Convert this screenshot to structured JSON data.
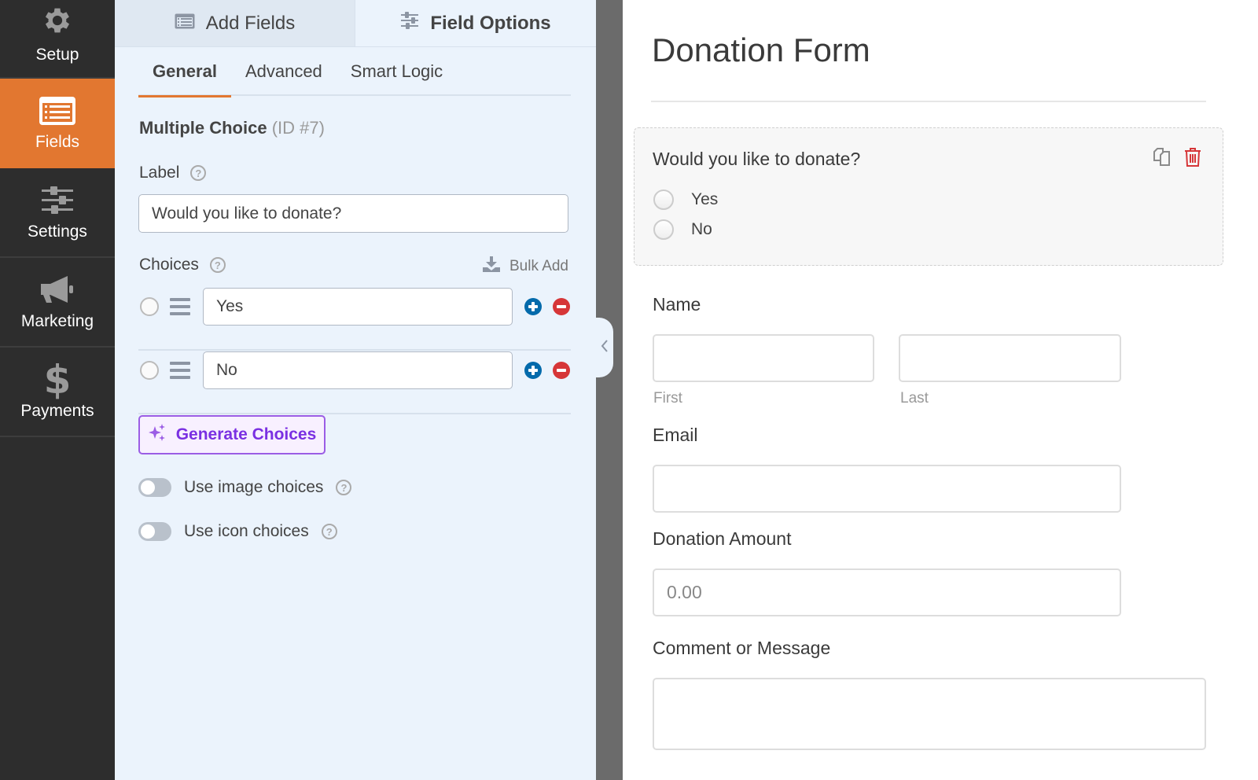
{
  "nav": {
    "items": [
      {
        "label": "Setup",
        "icon": "gear-icon",
        "active": false
      },
      {
        "label": "Fields",
        "icon": "list-form-icon",
        "active": true
      },
      {
        "label": "Settings",
        "icon": "sliders-icon",
        "active": false
      },
      {
        "label": "Marketing",
        "icon": "megaphone-icon",
        "active": false
      },
      {
        "label": "Payments",
        "icon": "dollar-icon",
        "active": false
      }
    ]
  },
  "panel": {
    "top_tabs": [
      {
        "label": "Add Fields",
        "icon": "list-icon",
        "active": false
      },
      {
        "label": "Field Options",
        "icon": "sliders-icon",
        "active": true
      }
    ],
    "sub_tabs": [
      {
        "label": "General",
        "active": true
      },
      {
        "label": "Advanced",
        "active": false
      },
      {
        "label": "Smart Logic",
        "active": false
      }
    ],
    "field_type": "Multiple Choice",
    "field_id": "(ID #7)",
    "label_caption": "Label",
    "label_value": "Would you like to donate?",
    "choices_caption": "Choices",
    "bulk_add": "Bulk Add",
    "choices": [
      {
        "value": "Yes"
      },
      {
        "value": "No"
      }
    ],
    "generate_button": "Generate Choices",
    "toggles": [
      {
        "label": "Use image choices",
        "on": false
      },
      {
        "label": "Use icon choices",
        "on": false
      }
    ],
    "help_glyph": "?"
  },
  "preview": {
    "form_title": "Donation Form",
    "mc_field": {
      "question": "Would you like to donate?",
      "options": [
        "Yes",
        "No"
      ]
    },
    "name_label": "Name",
    "first_sublabel": "First",
    "last_sublabel": "Last",
    "email_label": "Email",
    "amount_label": "Donation Amount",
    "amount_placeholder": "0.00",
    "comment_label": "Comment or Message"
  },
  "colors": {
    "accent": "#e27730",
    "nav_bg": "#2d2d2d",
    "panel_bg": "#ebf3fc",
    "add_blue": "#036aab",
    "remove_red": "#d63638",
    "ai_purple": "#7a30e2"
  }
}
